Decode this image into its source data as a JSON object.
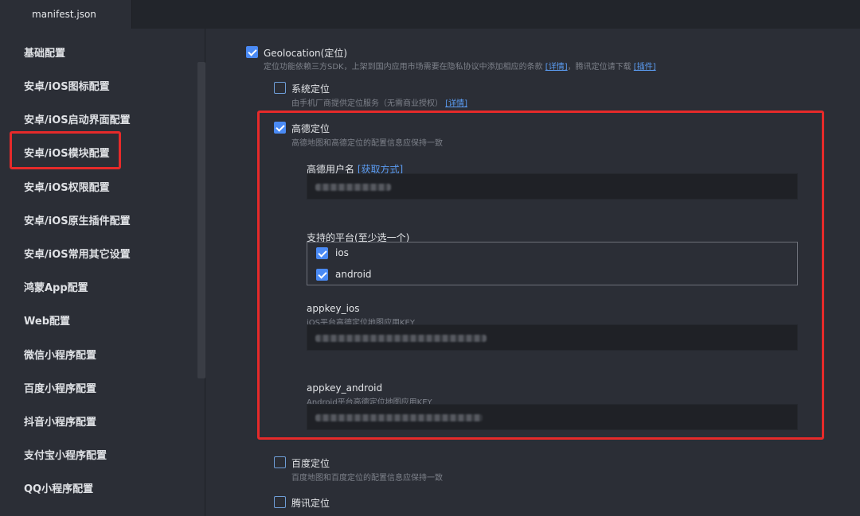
{
  "tab": {
    "filename": "manifest.json"
  },
  "sidebar": {
    "items": [
      {
        "label": "基础配置"
      },
      {
        "label": "安卓/iOS图标配置"
      },
      {
        "label": "安卓/iOS启动界面配置"
      },
      {
        "label": "安卓/iOS模块配置"
      },
      {
        "label": "安卓/iOS权限配置"
      },
      {
        "label": "安卓/iOS原生插件配置"
      },
      {
        "label": "安卓/iOS常用其它设置"
      },
      {
        "label": "鸿蒙App配置"
      },
      {
        "label": "Web配置"
      },
      {
        "label": "微信小程序配置"
      },
      {
        "label": "百度小程序配置"
      },
      {
        "label": "抖音小程序配置"
      },
      {
        "label": "支付宝小程序配置"
      },
      {
        "label": "QQ小程序配置"
      }
    ],
    "active_index": 3
  },
  "geolocation": {
    "label": "Geolocation(定位)",
    "checked": true,
    "desc": "定位功能依赖三方SDK，上架到国内应用市场需要在隐私协议中添加相应的条款",
    "detail_link": "[详情]",
    "desc2": "，腾讯定位请下载",
    "plugin_link": "[插件]"
  },
  "system_location": {
    "label": "系统定位",
    "checked": false,
    "desc": "由手机厂商提供定位服务（无需商业授权）",
    "detail_link": "[详情]"
  },
  "amap": {
    "label": "高德定位",
    "checked": true,
    "desc": "高德地图和高德定位的配置信息应保持一致",
    "username_label": "高德用户名",
    "username_link": "[获取方式]",
    "platforms_label": "支持的平台(至少选一个)",
    "platforms": [
      {
        "label": "ios",
        "checked": true
      },
      {
        "label": "android",
        "checked": true
      }
    ],
    "appkey_ios_label": "appkey_ios",
    "appkey_ios_desc": "iOS平台高德定位地图应用KEY",
    "appkey_android_label": "appkey_android",
    "appkey_android_desc": "Android平台高德定位地图应用KEY"
  },
  "baidu_location": {
    "label": "百度定位",
    "checked": false,
    "desc": "百度地图和百度定位的配置信息应保持一致"
  },
  "tencent_location": {
    "label": "腾讯定位",
    "checked": false
  },
  "colors": {
    "background": "#2b2e36",
    "accent": "#4a8af4",
    "highlight": "#e62a2a",
    "link": "#5b9cf2"
  }
}
